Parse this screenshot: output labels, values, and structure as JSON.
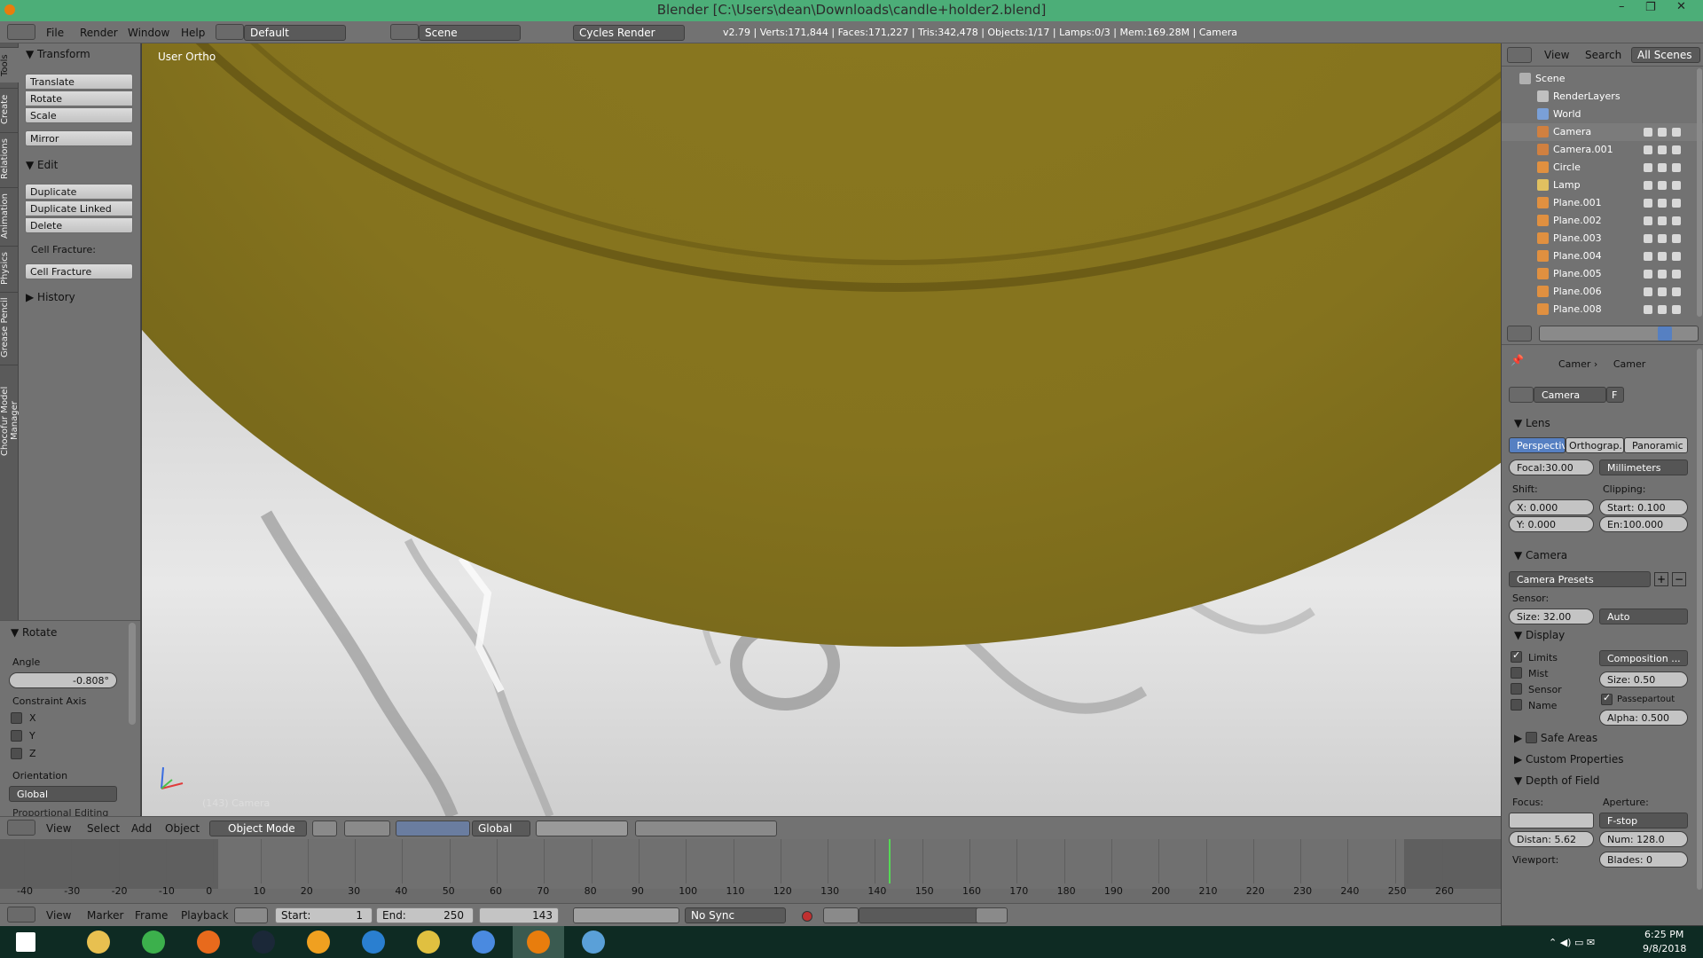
{
  "window": {
    "title": "Blender [C:\\Users\\dean\\Downloads\\candle+holder2.blend]",
    "minimize": "–",
    "maximize": "❐",
    "close": "✕"
  },
  "info": {
    "menus": [
      "File",
      "Render",
      "Window",
      "Help"
    ],
    "layout": "Default",
    "scene": "Scene",
    "engine": "Cycles Render",
    "stats": "v2.79 | Verts:171,844 | Faces:171,227 | Tris:342,478 | Objects:1/17 | Lamps:0/3 | Mem:169.28M | Camera"
  },
  "left_tabs": [
    "Tools",
    "Create",
    "Relations",
    "Animation",
    "Physics",
    "Grease Pencil",
    "Chocofur Model Manager"
  ],
  "toolshelf": {
    "transform": {
      "header": "Transform",
      "buttons": [
        "Translate",
        "Rotate",
        "Scale"
      ],
      "mirror": "Mirror"
    },
    "edit": {
      "header": "Edit",
      "buttons": [
        "Duplicate",
        "Duplicate Linked",
        "Delete"
      ],
      "cell_label": "Cell Fracture:",
      "cell_button": "Cell Fracture"
    },
    "history": "History",
    "operator": {
      "header": "Rotate",
      "angle_label": "Angle",
      "angle_value": "-0.808°",
      "axis_label": "Constraint Axis",
      "axes": [
        "X",
        "Y",
        "Z"
      ],
      "orient_label": "Orientation",
      "orient_value": "Global",
      "cut_label": "Proportional Editing"
    }
  },
  "viewport": {
    "view_label": "User Ortho",
    "object_label": "(143) Camera"
  },
  "vp_header": {
    "menus": [
      "View",
      "Select",
      "Add",
      "Object"
    ],
    "mode": "Object Mode",
    "orientation": "Global"
  },
  "timeline": {
    "ticks": [
      "-40",
      "-30",
      "-20",
      "-10",
      "0",
      "10",
      "20",
      "30",
      "40",
      "50",
      "60",
      "70",
      "80",
      "90",
      "100",
      "110",
      "120",
      "130",
      "140",
      "150",
      "160",
      "170",
      "180",
      "190",
      "200",
      "210",
      "220",
      "230",
      "240",
      "250",
      "260"
    ],
    "current_frame": 143,
    "menus": [
      "View",
      "Marker",
      "Frame",
      "Playback"
    ],
    "start": "Start:",
    "start_val": "1",
    "end": "End:",
    "end_val": "250",
    "frame": "143",
    "sync": "No Sync"
  },
  "outliner": {
    "menus": [
      "View",
      "Search",
      "All Scenes"
    ],
    "items": [
      {
        "name": "Scene",
        "type": "scene",
        "indent": 0
      },
      {
        "name": "RenderLayers",
        "type": "render",
        "indent": 1
      },
      {
        "name": "World",
        "type": "world",
        "indent": 1
      },
      {
        "name": "Camera",
        "type": "camera",
        "indent": 1
      },
      {
        "name": "Camera.001",
        "type": "camera",
        "indent": 1
      },
      {
        "name": "Circle",
        "type": "mesh",
        "indent": 1
      },
      {
        "name": "Lamp",
        "type": "lamp",
        "indent": 1
      },
      {
        "name": "Plane.001",
        "type": "mesh",
        "indent": 1
      },
      {
        "name": "Plane.002",
        "type": "mesh",
        "indent": 1
      },
      {
        "name": "Plane.003",
        "type": "mesh",
        "indent": 1
      },
      {
        "name": "Plane.004",
        "type": "mesh",
        "indent": 1
      },
      {
        "name": "Plane.005",
        "type": "mesh",
        "indent": 1
      },
      {
        "name": "Plane.006",
        "type": "mesh",
        "indent": 1
      },
      {
        "name": "Plane.008",
        "type": "mesh",
        "indent": 1
      }
    ]
  },
  "props": {
    "breadcrumb": [
      "Camer",
      "Camer"
    ],
    "datablock": "Camera",
    "fake_user": "F",
    "lens": {
      "header": "Lens",
      "types": [
        "Perspective",
        "Orthograp...",
        "Panoramic"
      ],
      "focal": "Focal:30.00",
      "unit": "Millimeters",
      "shift": "Shift:",
      "shift_x": "X:       0.000",
      "shift_y": "Y:       0.000",
      "clipping": "Clipping:",
      "clip_start": "Start: 0.100",
      "clip_end": "En:100.000"
    },
    "camera": {
      "header": "Camera",
      "presets": "Camera Presets",
      "sensor": "Sensor:",
      "size": "Size:  32.00",
      "fit": "Auto"
    },
    "display": {
      "header": "Display",
      "limits": "Limits",
      "mist": "Mist",
      "sensor": "Sensor",
      "name": "Name",
      "composition": "Composition ...",
      "size": "Size:     0.50",
      "passepartout": "Passepartout",
      "alpha": "Alpha: 0.500"
    },
    "safe_areas": "Safe Areas",
    "custom": "Custom Properties",
    "dof": {
      "header": "Depth of Field",
      "focus": "Focus:",
      "aperture": "Aperture:",
      "fstop": "F-stop",
      "distance": "Distan: 5.62",
      "num": "Num: 128.0",
      "viewport": "Viewport:",
      "blades": "Blades:      0"
    }
  },
  "taskbar": {
    "time": "6:25 PM",
    "date": "9/8/2018",
    "apps": [
      "windows-start-icon",
      "file-explorer-icon",
      "store-icon",
      "firefox-icon",
      "steam-icon",
      "half-life-icon",
      "edge-icon",
      "chrome-icon",
      "chrome-alt-icon",
      "blender-icon",
      "window-app-icon"
    ]
  },
  "colors": {
    "title": "#4cae78",
    "gold": "#85731e",
    "panel": "#727272",
    "selected": "#5680c2",
    "taskbar": "#0e2b23"
  }
}
